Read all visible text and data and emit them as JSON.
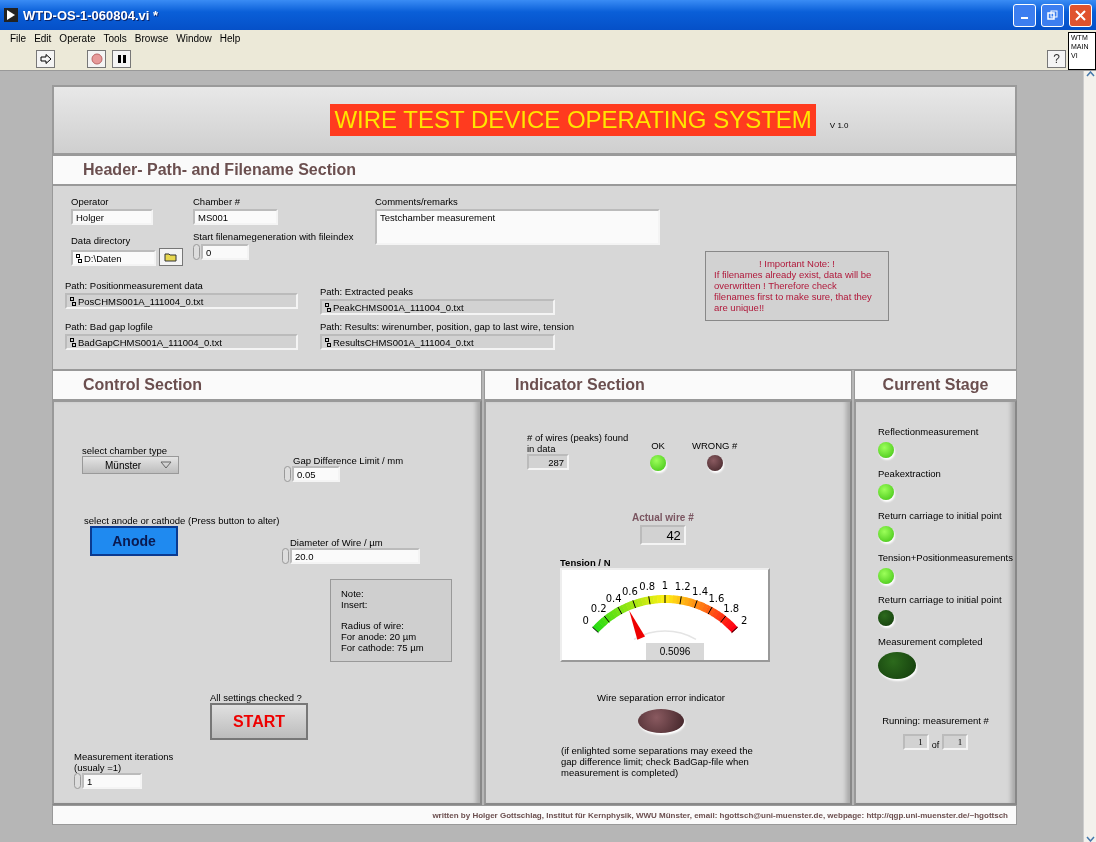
{
  "window": {
    "title": "WTD-OS-1-060804.vi *"
  },
  "menu": [
    "File",
    "Edit",
    "Operate",
    "Tools",
    "Browse",
    "Window",
    "Help"
  ],
  "help_button": "?",
  "vi_icon": [
    "WTM",
    "MAIN",
    "VI"
  ],
  "banner": {
    "title": "WIRE TEST DEVICE OPERATING SYSTEM",
    "version": "V 1.0"
  },
  "header_section": {
    "title": "Header- Path- and Filename Section",
    "operator": {
      "label": "Operator",
      "value": "Holger"
    },
    "chamber": {
      "label": "Chamber #",
      "value": "MS001"
    },
    "comments": {
      "label": "Comments/remarks",
      "value": "Testchamber measurement"
    },
    "data_directory": {
      "label": "Data directory",
      "value": "D:\\Daten"
    },
    "file_index": {
      "label": "Start filenamegeneration with fileindex",
      "value": "0"
    },
    "note": {
      "heading": "! Important Note: !",
      "text": "If filenames already exist, data will be overwritten ! Therefore check filenames first to make sure, that they are unique!!"
    },
    "paths": [
      {
        "label": "Path: Positionmeasurement data",
        "value": "PosCHMS001A_111004_0.txt"
      },
      {
        "label": "Path: Extracted peaks",
        "value": "PeakCHMS001A_111004_0.txt"
      },
      {
        "label": "Path: Bad gap logfile",
        "value": "BadGapCHMS001A_111004_0.txt"
      },
      {
        "label": "Path: Results: wirenumber, position, gap to last wire, tension",
        "value": "ResultsCHMS001A_111004_0.txt"
      }
    ]
  },
  "control_section": {
    "title": "Control Section",
    "chamber_type": {
      "label": "select chamber type",
      "value": "Münster"
    },
    "gap_limit": {
      "label": "Gap Difference Limit / mm",
      "value": "0.05"
    },
    "electrode": {
      "label": "select anode or cathode (Press button to alter)",
      "value": "Anode"
    },
    "diameter": {
      "label": "Diameter of Wire / µm",
      "value": "20.0"
    },
    "note": [
      [
        "Note:",
        "Insert:"
      ],
      [
        "Radius of wire:",
        "For anode: 20 µm",
        "For cathode: 75 µm"
      ]
    ],
    "start": {
      "label": "All settings checked ?",
      "button": "START"
    },
    "iterations": {
      "label": "Measurement iterations (usualy =1)",
      "value": "1"
    }
  },
  "indicator_section": {
    "title": "Indicator Section",
    "wires_found": {
      "label": "# of wires (peaks) found in data",
      "value": "287"
    },
    "leds": [
      {
        "label": "OK",
        "on": true
      },
      {
        "label": "WRONG #",
        "on": false
      }
    ],
    "actual_wire": {
      "label": "Actual wire #",
      "value": "42"
    },
    "tension": {
      "label": "Tension / N",
      "scale": [
        "0",
        "0.2",
        "0.4",
        "0.6",
        "0.8",
        "1",
        "1.2",
        "1.4",
        "1.6",
        "1.8",
        "2"
      ],
      "reading": "0.5096"
    },
    "separation_error": {
      "label": "Wire separation error indicator",
      "on": false,
      "note": "(if enlighted some separations may exeed the gap difference limit; check BadGap-file when measurement is completed)"
    }
  },
  "stage_section": {
    "title": "Current Stage",
    "stages": [
      {
        "label": "Reflectionmeasurement",
        "on": true
      },
      {
        "label": "Peakextraction",
        "on": true
      },
      {
        "label": "Return carriage to initial point",
        "on": true
      },
      {
        "label": "Tension+Positionmeasurements",
        "on": true
      },
      {
        "label": "Return carriage to initial point",
        "on": false
      }
    ],
    "completed": {
      "label": "Measurement completed",
      "on": false
    },
    "running": {
      "label": "Running: measurement #",
      "current": "1",
      "of": "of",
      "total": "1"
    }
  },
  "footer": "written by Holger Gottschlag, Institut für Kernphysik, WWU Münster, email:  hgottsch@uni-muenster.de, webpage: http://qgp.uni-muenster.de/~hgottsch"
}
